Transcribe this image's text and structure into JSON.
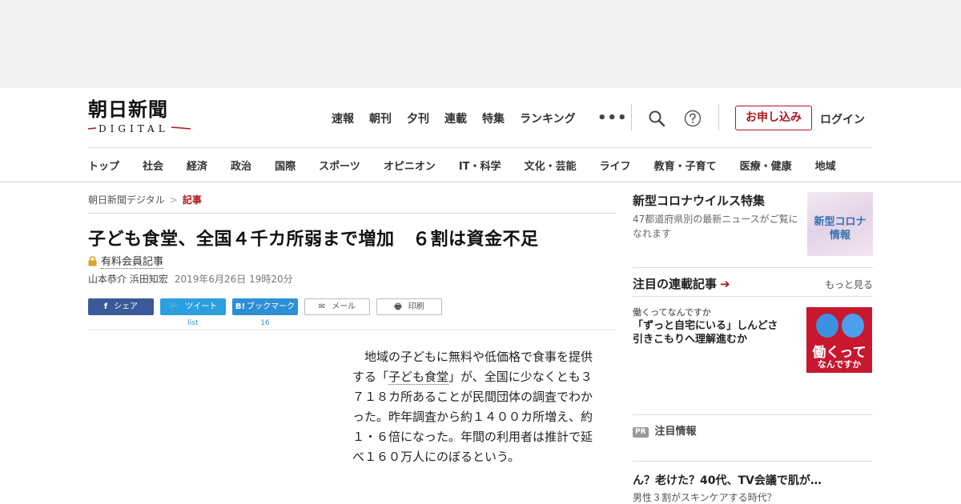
{
  "header": {
    "logo_jp": "朝日新聞",
    "logo_en": "DIGITAL",
    "topnav": [
      "速報",
      "朝刊",
      "夕刊",
      "連載",
      "特集",
      "ランキング"
    ],
    "more_dots": "•••",
    "apply_button": "お申し込み",
    "login": "ログイン",
    "sections": [
      "トップ",
      "社会",
      "経済",
      "政治",
      "国際",
      "スポーツ",
      "オピニオン",
      "IT・科学",
      "文化・芸能",
      "ライフ",
      "教育・子育て",
      "医療・健康",
      "地域"
    ]
  },
  "breadcrumb": {
    "home": "朝日新聞デジタル",
    "separator": ">",
    "current": "記事"
  },
  "article": {
    "title": "子ども食堂、全国４千カ所弱まで増加　６割は資金不足",
    "premium_label": "有料会員記事",
    "authors": "山本恭介 浜田知宏",
    "date": "2019年6月26日 19時20分",
    "share": {
      "facebook": {
        "icon": "f",
        "label": "シェア"
      },
      "twitter": {
        "icon": "🐦",
        "label": "ツイート",
        "count": "list"
      },
      "hatena": {
        "icon": "B!",
        "label": "ブックマーク",
        "count": "16"
      },
      "mail": {
        "icon": "✉",
        "label": "メール"
      },
      "print": {
        "icon": "🖶",
        "label": "印刷"
      }
    },
    "body_pre": "　地域の子どもに無料や低価格で食事を提供する「",
    "body_link": "子ども食堂",
    "body_post": "」が、全国に少なくとも３７１８カ所あることが民間団体の調査でわかった。昨年調査から約１４００カ所増え、約１・６倍になった。年間の利用者は推計で延べ１６０万人にのぼるという。"
  },
  "sidebar": {
    "corona": {
      "title": "新型コロナウイルス特集",
      "desc": "47都道府県別の最新ニュースがご覧になれます",
      "img_text": "新型コロナ\n情報"
    },
    "series": {
      "heading": "注目の連載記事",
      "arrow": "➔",
      "more": "もっと見る",
      "kicker": "働くってなんですか",
      "title": "「ずっと自宅にいる」しんどさ　引きこもりへ理解進むか",
      "img_title": "働くって",
      "img_sub": "なんですか"
    },
    "pr": {
      "badge": "PR",
      "heading": "注目情報",
      "title": "ん？老けた？40代、TV会議で肌が…",
      "sub": "男性３割がスキンケアする時代？"
    }
  },
  "colors": {
    "brand_red": "#b0151c",
    "facebook": "#3b5998",
    "twitter": "#2d9ee0",
    "hatena": "#2d8fd6"
  }
}
